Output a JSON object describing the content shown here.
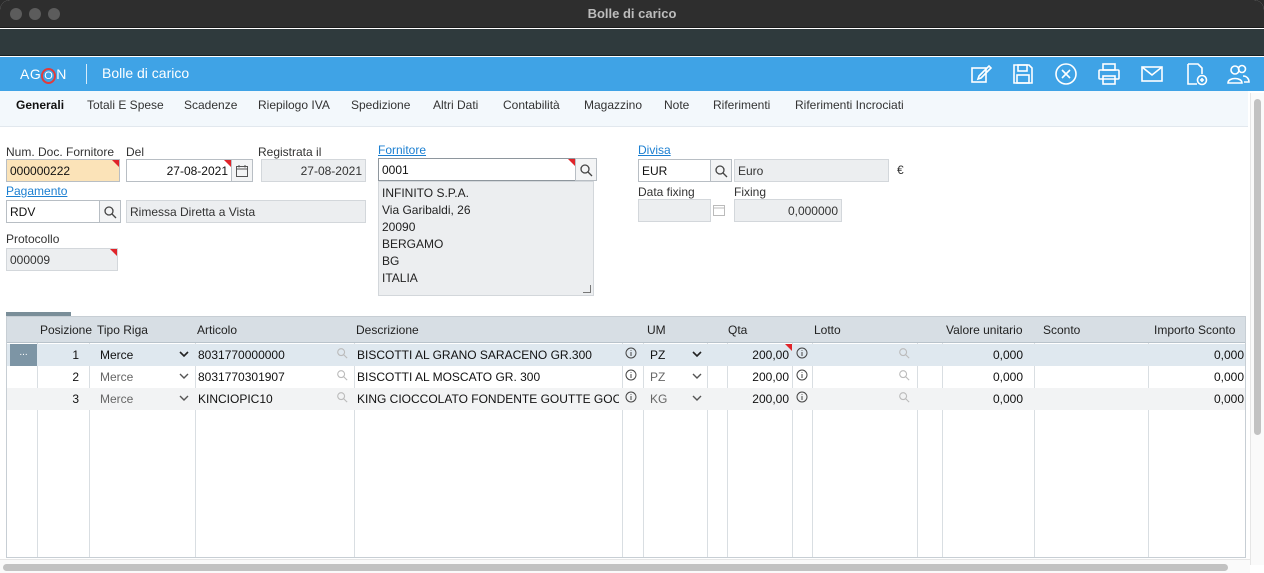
{
  "window": {
    "title": "Bolle di carico"
  },
  "app": {
    "logo": "AGON",
    "title": "Bolle di carico"
  },
  "toolbar": [
    "edit-icon",
    "save-icon",
    "cancel-icon",
    "print-icon",
    "mail-icon",
    "export-icon",
    "users-icon"
  ],
  "tabs": [
    {
      "label": "Generali",
      "active": true
    },
    {
      "label": "Totali E Spese"
    },
    {
      "label": "Scadenze"
    },
    {
      "label": "Riepilogo IVA"
    },
    {
      "label": "Spedizione"
    },
    {
      "label": "Altri Dati"
    },
    {
      "label": "Contabilità"
    },
    {
      "label": "Magazzino"
    },
    {
      "label": "Note"
    },
    {
      "label": "Riferimenti"
    },
    {
      "label": "Riferimenti Incrociati"
    }
  ],
  "form": {
    "num_doc_label": "Num. Doc. Fornitore",
    "num_doc_value": "000000222",
    "del_label": "Del",
    "del_value": "27-08-2021",
    "registrata_label": "Registrata il",
    "registrata_value": "27-08-2021",
    "fornitore_label": "Fornitore",
    "fornitore_value": "0001",
    "fornitore_address": [
      "INFINITO S.P.A.",
      "Via Garibaldi, 26",
      "20090",
      "BERGAMO",
      "BG",
      "ITALIA"
    ],
    "divisa_label": "Divisa",
    "divisa_code": "EUR",
    "divisa_desc": "Euro",
    "divisa_symbol": "€",
    "data_fixing_label": "Data fixing",
    "data_fixing_value": "",
    "fixing_label": "Fixing",
    "fixing_value": "0,000000",
    "pagamento_label": "Pagamento",
    "pagamento_code": "RDV",
    "pagamento_desc": "Rimessa Diretta a Vista",
    "protocollo_label": "Protocollo",
    "protocollo_value": "000009"
  },
  "grid": {
    "columns": [
      "Posizione",
      "Tipo Riga",
      "Articolo",
      "Descrizione",
      "UM",
      "Qta",
      "Lotto",
      "Valore unitario",
      "Sconto",
      "Importo Sconto"
    ],
    "row_handle": "...",
    "rows": [
      {
        "pos": "1",
        "tipo": "Merce",
        "articolo": "8031770000000",
        "descrizione": "BISCOTTI AL GRANO SARACENO GR.300",
        "um": "PZ",
        "qta": "200,00",
        "lotto": "",
        "valore": "0,000",
        "sconto": "",
        "importo": "0,000"
      },
      {
        "pos": "2",
        "tipo": "Merce",
        "articolo": "8031770301907",
        "descrizione": "BISCOTTI AL MOSCATO GR. 300",
        "um": "PZ",
        "qta": "200,00",
        "lotto": "",
        "valore": "0,000",
        "sconto": "",
        "importo": "0,000"
      },
      {
        "pos": "3",
        "tipo": "Merce",
        "articolo": "KINCIOPIC10",
        "descrizione": "KING CIOCCOLATO FONDENTE GOUTTE GOCC",
        "um": "KG",
        "qta": "200,00",
        "lotto": "",
        "valore": "0,000",
        "sconto": "",
        "importo": "0,000"
      }
    ]
  },
  "colors": {
    "accent": "#3fa3e6",
    "link": "#1b7fd1",
    "required_marker": "#e0242a",
    "highlight_field": "#fbe3b8"
  }
}
